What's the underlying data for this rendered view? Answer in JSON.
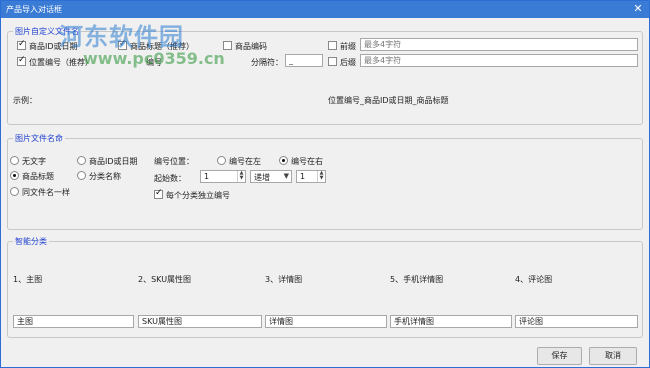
{
  "window": {
    "title": "产品导入对话框",
    "close_glyph": "✕"
  },
  "watermark": {
    "line1": "河东软件园",
    "line2": "www.pc0359.cn"
  },
  "file_name_group": {
    "title": "图片自定义文件名",
    "checkboxes": {
      "product_id": {
        "label": "商品ID或日期",
        "checked": true
      },
      "product_title": {
        "label": "商品标题（推荐）",
        "checked": true
      },
      "product_code": {
        "label": "商品编码",
        "checked": false
      },
      "position_code": {
        "label": "位置编号（推荐）",
        "checked": true
      },
      "prefix": {
        "label": "前缀",
        "checked": false
      },
      "suffix": {
        "label": "后缀",
        "checked": false
      }
    },
    "extra_label": "编号",
    "separator_label": "分隔符：",
    "separator_value": "_",
    "prefix_placeholder": "最多4字符",
    "suffix_placeholder": "最多4字符",
    "example_label": "示例：",
    "example_value": "位置编号_商品ID或日期_商品标题"
  },
  "image_name_group": {
    "title": "图片文件名命",
    "radios": {
      "no_text": {
        "label": "无文字",
        "checked": false
      },
      "product_title": {
        "label": "商品标题",
        "checked": true
      },
      "same_as_file": {
        "label": "同文件名一样",
        "checked": false
      },
      "product_id_date": {
        "label": "商品ID或日期",
        "checked": false
      },
      "category_name": {
        "label": "分类名称",
        "checked": false
      }
    },
    "position_label": "编号位置：",
    "position_left": {
      "label": "编号在左",
      "checked": false
    },
    "position_right": {
      "label": "编号在右",
      "checked": true
    },
    "start_label": "起始数：",
    "start_value": "1",
    "order_value": "递增",
    "step_value": "1",
    "independent": {
      "label": "每个分类独立编号",
      "checked": true
    }
  },
  "smart_group": {
    "title": "智能分类",
    "columns": [
      {
        "label": "1、主图",
        "value": "主图"
      },
      {
        "label": "2、SKU属性图",
        "value": "SKU属性图"
      },
      {
        "label": "3、详情图",
        "value": "详情图"
      },
      {
        "label": "5、手机详情图",
        "value": "手机详情图"
      },
      {
        "label": "4、评论图",
        "value": "评论图"
      }
    ]
  },
  "buttons": {
    "save": "保存",
    "cancel": "取消"
  }
}
